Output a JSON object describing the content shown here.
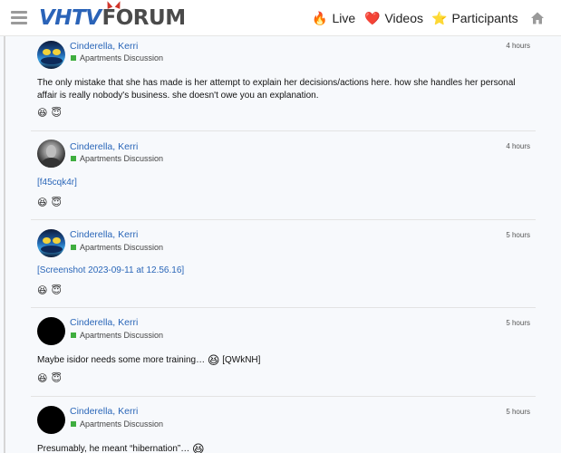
{
  "header": {
    "logo_vhtv": "VHTV",
    "logo_forum": "FORUM",
    "nav": {
      "live": {
        "icon": "🔥",
        "label": "Live"
      },
      "videos": {
        "icon": "❤️",
        "label": "Videos"
      },
      "participants": {
        "icon": "⭐",
        "label": "Participants"
      }
    }
  },
  "posts": [
    {
      "author": "Cinderella, Kerri",
      "category": "Apartments Discussion",
      "time": "4 hours",
      "avatar": "fish",
      "text": "The only mistake that she has made is her attempt to explain her decisions/actions here. how she handles her personal affair is really nobody's business. she doesn't owe you an explanation.",
      "reactions": [
        "😆",
        "😇"
      ]
    },
    {
      "author": "Cinderella, Kerri",
      "category": "Apartments Discussion",
      "time": "4 hours",
      "avatar": "photo",
      "link": "[f45cqk4r]",
      "reactions": [
        "😆",
        "😇"
      ]
    },
    {
      "author": "Cinderella, Kerri",
      "category": "Apartments Discussion",
      "time": "5 hours",
      "avatar": "fish",
      "link": "[Screenshot 2023-09-11 at 12.56.16]",
      "reactions": [
        "😆",
        "😇"
      ]
    },
    {
      "author": "Cinderella, Kerri",
      "category": "Apartments Discussion",
      "time": "5 hours",
      "avatar": "black",
      "text": "Maybe isidor needs some more training…",
      "text_emoji": "😆",
      "link": "[QWkNH]",
      "reactions": [
        "😆",
        "😇"
      ]
    },
    {
      "author": "Cinderella, Kerri",
      "category": "Apartments Discussion",
      "time": "5 hours",
      "avatar": "black",
      "text": "Presumably, he meant “hibernation”…",
      "text_emoji": "😆"
    }
  ]
}
